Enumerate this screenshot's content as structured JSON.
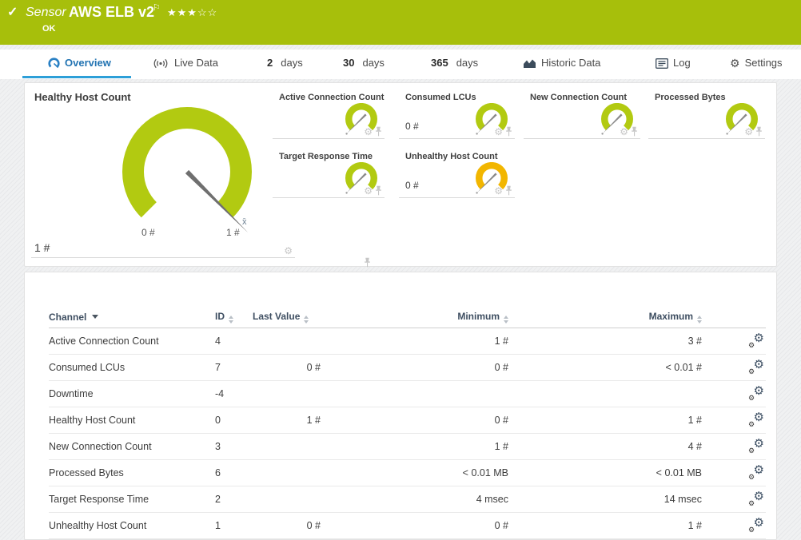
{
  "colors": {
    "status_green": "#a7bf0b",
    "gauge_green": "#b2ca11",
    "gauge_warning": "#f2b600",
    "accent_blue": "#2d9fd8"
  },
  "header": {
    "check_icon": "✓",
    "kind_label": "Sensor",
    "title": "AWS ELB v2",
    "flag_icon": "⚐",
    "stars_filled": "★★★",
    "stars_empty": "☆☆",
    "status": "OK"
  },
  "tabs": [
    {
      "prefix": "",
      "label": "Overview"
    },
    {
      "prefix": "",
      "label": "Live Data"
    },
    {
      "prefix": "2",
      "label": "days"
    },
    {
      "prefix": "30",
      "label": "days"
    },
    {
      "prefix": "365",
      "label": "days"
    },
    {
      "prefix": "",
      "label": "Historic Data"
    },
    {
      "prefix": "",
      "label": "Log"
    },
    {
      "prefix": "",
      "label": "Settings"
    },
    {
      "settings_gear_icon": "⚙"
    }
  ],
  "gauges": {
    "primary": {
      "title": "Healthy Host Count",
      "value": "1 #",
      "min_label": "0 #",
      "max_label": "1 #",
      "avg_marker": "x̄",
      "color": "#b2ca11"
    },
    "small": [
      {
        "title": "Active Connection Count",
        "value": "",
        "color": "#b2ca11"
      },
      {
        "title": "Consumed LCUs",
        "value": "0 #",
        "color": "#b2ca11"
      },
      {
        "title": "New Connection Count",
        "value": "",
        "color": "#b2ca11"
      },
      {
        "title": "Processed Bytes",
        "value": "",
        "color": "#b2ca11"
      },
      {
        "title": "Target Response Time",
        "value": "",
        "color": "#b2ca11"
      },
      {
        "title": "Unhealthy Host Count",
        "value": "0 #",
        "color": "#f2b600"
      }
    ],
    "gear_icon": "⚙"
  },
  "table": {
    "columns": {
      "channel": "Channel",
      "id": "ID",
      "last_value": "Last Value",
      "minimum": "Minimum",
      "maximum": "Maximum"
    },
    "gear_icon": "⚙",
    "rows": [
      {
        "channel": "Active Connection Count",
        "id": "4",
        "last": "",
        "min": "1 #",
        "max": "3 #"
      },
      {
        "channel": "Consumed LCUs",
        "id": "7",
        "last": "0 #",
        "min": "0 #",
        "max": "< 0.01 #"
      },
      {
        "channel": "Downtime",
        "id": "-4",
        "last": "",
        "min": "",
        "max": ""
      },
      {
        "channel": "Healthy Host Count",
        "id": "0",
        "last": "1 #",
        "min": "0 #",
        "max": "1 #"
      },
      {
        "channel": "New Connection Count",
        "id": "3",
        "last": "",
        "min": "1 #",
        "max": "4 #"
      },
      {
        "channel": "Processed Bytes",
        "id": "6",
        "last": "",
        "min": "< 0.01 MB",
        "max": "< 0.01 MB"
      },
      {
        "channel": "Target Response Time",
        "id": "2",
        "last": "",
        "min": "4 msec",
        "max": "14 msec"
      },
      {
        "channel": "Unhealthy Host Count",
        "id": "1",
        "last": "0 #",
        "min": "0 #",
        "max": "1 #"
      }
    ]
  }
}
